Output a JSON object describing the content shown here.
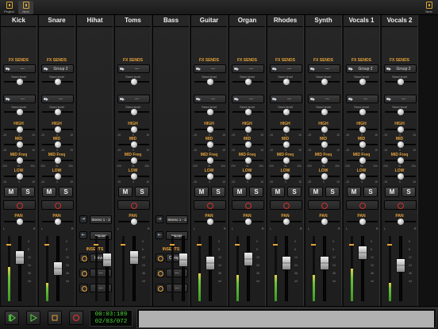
{
  "topbar": {
    "left_buttons": [
      {
        "label": "Project",
        "icon": "project-icon",
        "active": false
      },
      {
        "label": "Next",
        "icon": "next-icon",
        "active": true
      }
    ],
    "right_button": {
      "label": "Next",
      "icon": "next-icon"
    }
  },
  "labels": {
    "fx_sends": "FX SENDS",
    "send_level": "Send level",
    "high": "HIGH",
    "mid": "MID",
    "mid_freq": "MID Freq",
    "low": "LOW",
    "pan": "PAN",
    "mute": "M",
    "solo": "S",
    "inserts": "INSERTS",
    "eq_scale": {
      "min": "-15",
      "mid": "0",
      "max": "15"
    },
    "freq_scale": {
      "min": "200",
      "mid": "2k",
      "max": "20k"
    },
    "pan_scale": {
      "left": "L",
      "right": "R"
    },
    "db_ticks": [
      "0",
      "6",
      "12",
      "24",
      "36",
      "inf"
    ]
  },
  "accent_color": "#e7a33a",
  "channels": [
    {
      "name": "Kick",
      "type": "audio",
      "send1": "---",
      "send2": "---",
      "fader": 0.72,
      "meter": 0.55
    },
    {
      "name": "Snare",
      "type": "audio",
      "send1": "Group 2",
      "send2": "---",
      "fader": 0.52,
      "meter": 0.3
    },
    {
      "name": "Hihat",
      "type": "bus",
      "output": "Stereo 1 - 2",
      "master": "Master",
      "inserts": [
        "Reverb",
        "---",
        "---"
      ],
      "fader": 0.68,
      "meter": 0.0
    },
    {
      "name": "Toms",
      "type": "audio",
      "send1": "---",
      "send2": "---",
      "fader": 0.72,
      "meter": 0.0
    },
    {
      "name": "Bass",
      "type": "bus",
      "output": "Stereo 1 - 2",
      "master": "Master",
      "inserts": [
        "Compres",
        "---",
        "---"
      ],
      "fader": 0.68,
      "meter": 0.0
    },
    {
      "name": "Guitar",
      "type": "audio",
      "send1": "---",
      "send2": "---",
      "fader": 0.62,
      "meter": 0.45
    },
    {
      "name": "Organ",
      "type": "audio",
      "send1": "---",
      "send2": "---",
      "fader": 0.7,
      "meter": 0.42
    },
    {
      "name": "Rhodes",
      "type": "audio",
      "send1": "---",
      "send2": "---",
      "fader": 0.62,
      "meter": 0.42
    },
    {
      "name": "Synth",
      "type": "audio",
      "send1": "---",
      "send2": "---",
      "fader": 0.62,
      "meter": 0.42
    },
    {
      "name": "Vocals 1",
      "type": "audio",
      "send1": "Group 2",
      "send2": "---",
      "fader": 0.82,
      "meter": 0.52
    },
    {
      "name": "Vocals 2",
      "type": "audio",
      "send1": "Group 2",
      "send2": "---",
      "fader": 0.58,
      "meter": 0.3
    }
  ],
  "transport": {
    "time": "00:03:189",
    "position": "02/03/072"
  }
}
